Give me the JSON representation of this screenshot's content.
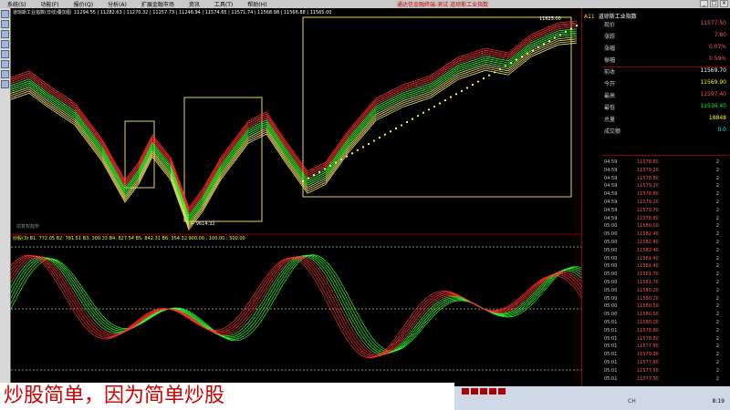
{
  "menu": {
    "items": [
      "系统(S)",
      "功能(F)",
      "报价(Q)",
      "分析(A)",
      "扩展金融市场",
      "资讯",
      "工具(T)",
      "帮助(H)"
    ],
    "center_title": "通达信金融终端-测试   道琼斯工业指数"
  },
  "chart": {
    "header": "道琼斯工业指数(日线)叠加图",
    "ohlc_line": "11294.55 | 11282.63 | 11270.32 | 11257.73 | 11246.94 | 11574.65 | 11571.74 | 11568.98 | 11566.88 | 11565.00",
    "low_label": "← 9614.32",
    "high_label": "11625.00",
    "indicator_line": "炒股(3) B1: 772.05  B2: 781.51  B3: 300.33  B4: 827.54  B5: 842.31  B6: 354.32    900.00 : 100.00 : 500.00",
    "lower_scale": "900.00",
    "bottom_label": "前复权趋势"
  },
  "panel": {
    "code": "A11",
    "name": "道琼斯工业指数",
    "fields": [
      {
        "k": "现价",
        "v": "11577.50",
        "c": "#ff5a5a"
      },
      {
        "k": "涨跌",
        "v": "7.80",
        "c": "#ff5a5a"
      },
      {
        "k": "涨幅",
        "v": "0.07%",
        "c": "#ff5a5a"
      },
      {
        "k": "振幅",
        "v": "0.59%",
        "c": "#ff5a5a"
      },
      {
        "k": "前收",
        "v": "11569.70",
        "c": "#ffffff"
      },
      {
        "k": "今开",
        "v": "11569.90",
        "c": "#ffff00"
      },
      {
        "k": "最高",
        "v": "11597.40",
        "c": "#ff5a5a"
      },
      {
        "k": "最低",
        "v": "11530.40",
        "c": "#00ff00"
      },
      {
        "k": "总量",
        "v": "18848",
        "c": "#ffff00"
      },
      {
        "k": "成交额",
        "v": "0.0",
        "c": "#00ffff"
      }
    ],
    "ticks": [
      {
        "t": "04:59",
        "p": "11578.80",
        "v": "2"
      },
      {
        "t": "04:59",
        "p": "11579.20",
        "v": "2"
      },
      {
        "t": "04:59",
        "p": "11578.80",
        "v": "2"
      },
      {
        "t": "04:59",
        "p": "11579.20",
        "v": "2"
      },
      {
        "t": "04:59",
        "p": "11578.80",
        "v": "2"
      },
      {
        "t": "04:59",
        "p": "11579.20",
        "v": "2"
      },
      {
        "t": "04:59",
        "p": "11579.70",
        "v": "2"
      },
      {
        "t": "04:59",
        "p": "11578.80",
        "v": "2"
      },
      {
        "t": "05:00",
        "p": "11580.00",
        "v": "2"
      },
      {
        "t": "05:00",
        "p": "11582.40",
        "v": "2"
      },
      {
        "t": "05:00",
        "p": "11582.40",
        "v": "2"
      },
      {
        "t": "05:00",
        "p": "11582.40",
        "v": "2"
      },
      {
        "t": "05:00",
        "p": "11581.40",
        "v": "2"
      },
      {
        "t": "05:00",
        "p": "11581.40",
        "v": "2"
      },
      {
        "t": "05:00",
        "p": "11581.70",
        "v": "2"
      },
      {
        "t": "05:00",
        "p": "11581.70",
        "v": "2"
      },
      {
        "t": "05:00",
        "p": "11580.20",
        "v": "2"
      },
      {
        "t": "05:00",
        "p": "11580.20",
        "v": "2"
      },
      {
        "t": "05:00",
        "p": "11580.50",
        "v": "2"
      },
      {
        "t": "05:00",
        "p": "11580.50",
        "v": "2"
      },
      {
        "t": "05:01",
        "p": "11580.00",
        "v": "2"
      },
      {
        "t": "05:01",
        "p": "11578.80",
        "v": "2"
      },
      {
        "t": "05:01",
        "p": "11578.80",
        "v": "2"
      },
      {
        "t": "05:01",
        "p": "11577.80",
        "v": "2"
      },
      {
        "t": "05:01",
        "p": "11579.00",
        "v": "2"
      },
      {
        "t": "05:01",
        "p": "11577.80",
        "v": "2"
      },
      {
        "t": "05:01",
        "p": "11577.50",
        "v": "2"
      },
      {
        "t": "05:01",
        "p": "11577.50",
        "v": "2"
      }
    ]
  },
  "caption": "炒股简单，因为简单炒股",
  "taskbar": {
    "clock": "8:19",
    "tray": "CH"
  }
}
